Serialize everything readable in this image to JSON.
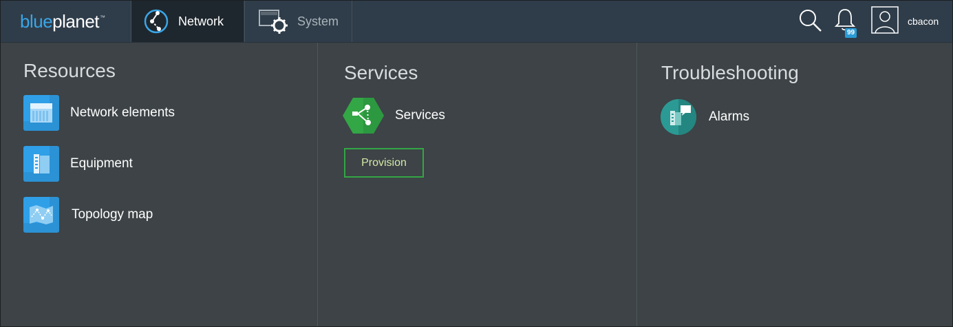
{
  "brand": {
    "part1": "blue",
    "part2": "planet",
    "mark": "™"
  },
  "tabs": [
    {
      "label": "Network",
      "icon": "network-topology-icon"
    },
    {
      "label": "System",
      "icon": "system-gear-icon"
    }
  ],
  "header": {
    "notification_count": "99",
    "username": "cbacon",
    "icons": [
      "search-icon",
      "bell-icon",
      "user-avatar-icon"
    ]
  },
  "resources": {
    "heading": "Resources",
    "items": [
      {
        "label": "Network elements",
        "icon": "network-elements-icon"
      },
      {
        "label": "Equipment",
        "icon": "equipment-icon"
      },
      {
        "label": "Topology map",
        "icon": "topology-map-icon"
      }
    ]
  },
  "services": {
    "heading": "Services",
    "items": [
      {
        "label": "Services",
        "icon": "services-share-icon"
      }
    ],
    "provision_label": "Provision"
  },
  "troubleshooting": {
    "heading": "Troubleshooting",
    "items": [
      {
        "label": "Alarms",
        "icon": "alarms-icon"
      }
    ]
  },
  "colors": {
    "topbar": "#2f3d4a",
    "active_tab": "#1f272e",
    "body": "#3d4346",
    "accent_blue": "#2f9fe8",
    "accent_green": "#33a645",
    "accent_teal": "#2b9a94"
  }
}
